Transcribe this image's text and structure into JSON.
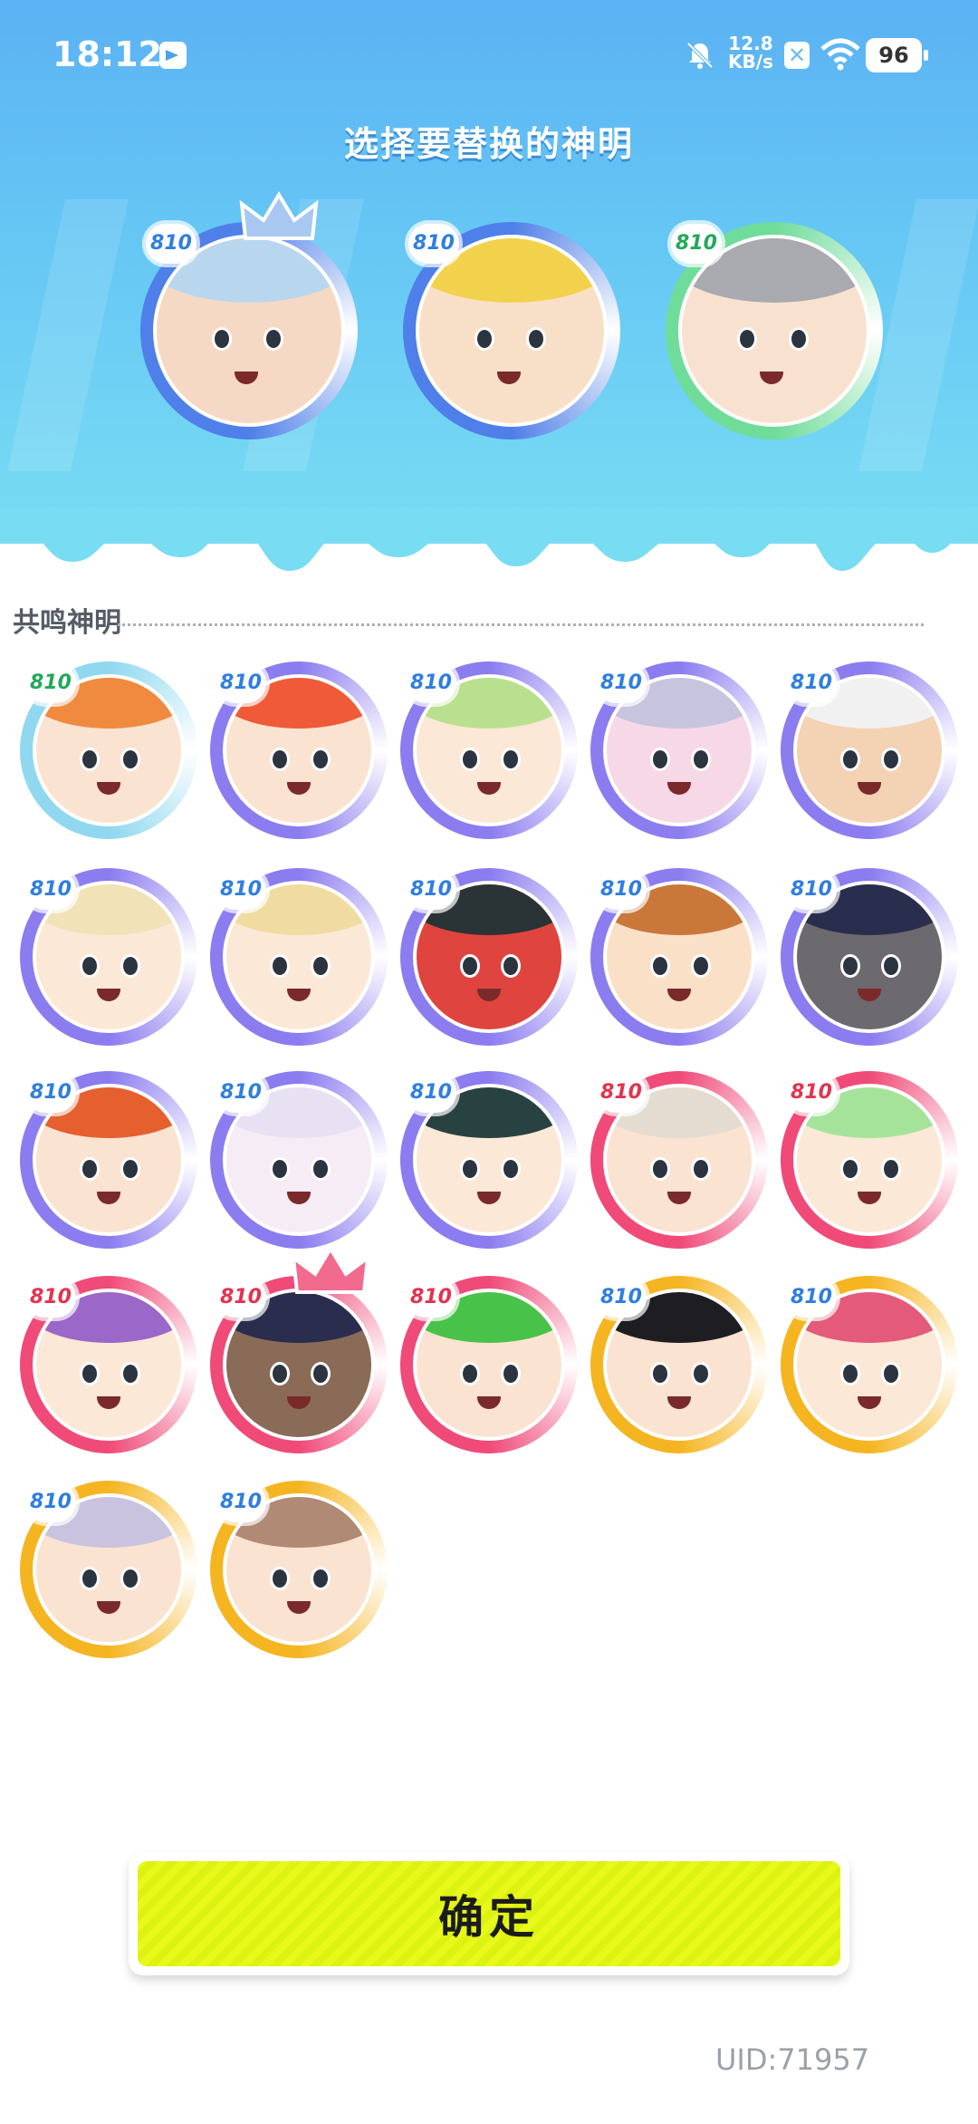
{
  "status_bar": {
    "time": "18:12",
    "net_speed_value": "12.8",
    "net_speed_unit": "KB/s",
    "battery": "96"
  },
  "title": "选择要替换的神明",
  "selected": [
    {
      "level": "810",
      "ring": "#4f7fe8",
      "skin": "#f6d9c4",
      "hair": "#b9d6ef",
      "crown": true
    },
    {
      "level": "810",
      "ring": "#4f7fe8",
      "skin": "#f8e0c8",
      "hair": "#f2d24d",
      "crown": false
    },
    {
      "level": "810",
      "ring": "#6fdc9a",
      "skin": "#f8e2cf",
      "hair": "#a9aab0",
      "crown": false
    }
  ],
  "section_label": "共鸣神明",
  "resonance": [
    {
      "level": "810",
      "ring": "#8fd8f0",
      "skin": "#fbe3d1",
      "hair": "#f08a3e"
    },
    {
      "level": "810",
      "ring": "#8b7cf0",
      "skin": "#fbe3d1",
      "hair": "#ef5a38"
    },
    {
      "level": "810",
      "ring": "#8b7cf0",
      "skin": "#fbe8d6",
      "hair": "#b9e08f"
    },
    {
      "level": "810",
      "ring": "#8b7cf0",
      "skin": "#f7d8e6",
      "hair": "#c7c4de"
    },
    {
      "level": "810",
      "ring": "#8b7cf0",
      "skin": "#f4d2b4",
      "hair": "#f1f1f1"
    },
    {
      "level": "810",
      "ring": "#8b7cf0",
      "skin": "#fbe8d6",
      "hair": "#f1e2b8"
    },
    {
      "level": "810",
      "ring": "#8b7cf0",
      "skin": "#fbe8d6",
      "hair": "#f0dca0"
    },
    {
      "level": "810",
      "ring": "#8b7cf0",
      "skin": "#e0443e",
      "hair": "#2a3336"
    },
    {
      "level": "810",
      "ring": "#8b7cf0",
      "skin": "#fbe0c8",
      "hair": "#c9783a"
    },
    {
      "level": "810",
      "ring": "#8b7cf0",
      "skin": "#6c6a6e",
      "hair": "#2a2e4e"
    },
    {
      "level": "810",
      "ring": "#8b7cf0",
      "skin": "#fbe3d1",
      "hair": "#e5602e"
    },
    {
      "level": "810",
      "ring": "#8b7cf0",
      "skin": "#f5ecf5",
      "hair": "#e8e1f3"
    },
    {
      "level": "810",
      "ring": "#8b7cf0",
      "skin": "#fbe8d6",
      "hair": "#284242"
    },
    {
      "level": "810",
      "ring": "#f04a78",
      "skin": "#fbe3d1",
      "hair": "#e4dcd0"
    },
    {
      "level": "810",
      "ring": "#f04a78",
      "skin": "#fbe8d6",
      "hair": "#a6e39a"
    },
    {
      "level": "810",
      "ring": "#f04a78",
      "skin": "#fbe8d6",
      "hair": "#9b67c9"
    },
    {
      "level": "810",
      "ring": "#f04a78",
      "skin": "#8a6b57",
      "hair": "#2b2d4e",
      "crown": true
    },
    {
      "level": "810",
      "ring": "#f04a78",
      "skin": "#fbe3d1",
      "hair": "#48c249"
    },
    {
      "level": "810",
      "ring": "#f5b521",
      "skin": "#fbe3d1",
      "hair": "#1e1e22"
    },
    {
      "level": "810",
      "ring": "#f5b521",
      "skin": "#fbe8d6",
      "hair": "#e35a7b"
    },
    {
      "level": "810",
      "ring": "#f5b521",
      "skin": "#fbe3d1",
      "hair": "#c9c3e0"
    },
    {
      "level": "810",
      "ring": "#f5b521",
      "skin": "#fbe3d1",
      "hair": "#b08a74"
    }
  ],
  "confirm_label": "确定",
  "uid": "UID:71957"
}
